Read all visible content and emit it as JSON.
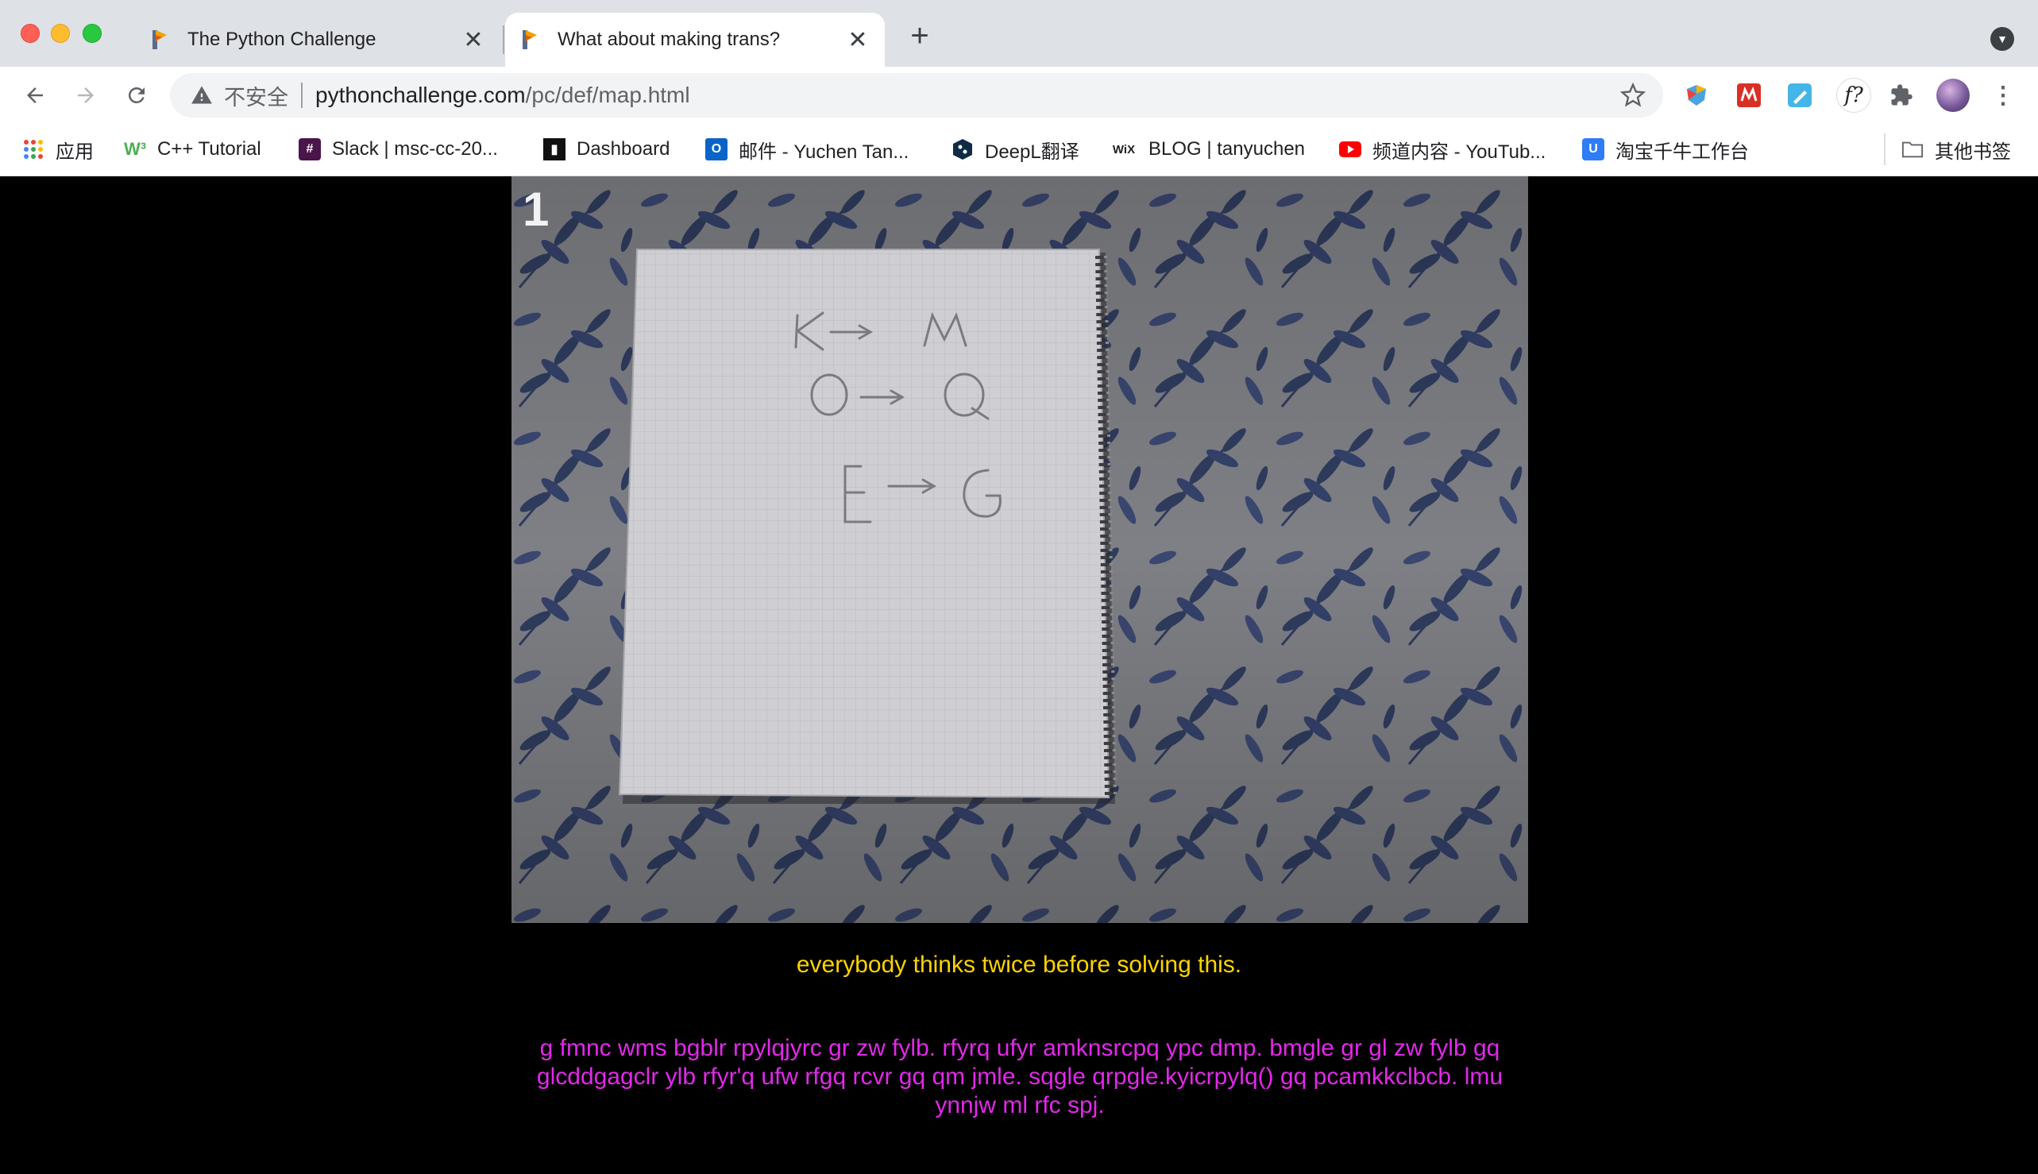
{
  "browser": {
    "tabs": [
      {
        "title": "The Python Challenge",
        "active": false
      },
      {
        "title": "What about making trans?",
        "active": true
      }
    ],
    "address": {
      "security_label": "不安全",
      "host": "pythonchallenge.com",
      "path": "/pc/def/map.html"
    },
    "extensions": [
      "colorful-shield-icon",
      "red-grid-extension-icon",
      "blue-pen-extension-icon",
      "formula-extension-icon",
      "puzzle-icon",
      "profile-avatar"
    ],
    "bookmarks": [
      {
        "label": "应用",
        "icon": "apps-grid-icon"
      },
      {
        "label": "C++ Tutorial",
        "icon": "w3schools-icon"
      },
      {
        "label": "Slack | msc-cc-20...",
        "icon": "slack-icon"
      },
      {
        "label": "Dashboard",
        "icon": "dashboard-icon"
      },
      {
        "label": "邮件 - Yuchen Tan...",
        "icon": "outlook-icon"
      },
      {
        "label": "DeepL翻译",
        "icon": "deepl-icon"
      },
      {
        "label": "BLOG | tanyuchen",
        "icon": "wix-icon"
      },
      {
        "label": "频道内容 - YouTub...",
        "icon": "youtube-icon"
      },
      {
        "label": "淘宝千牛工作台",
        "icon": "qianniu-icon"
      }
    ],
    "other_bookmarks": "其他书签"
  },
  "page": {
    "image": {
      "level_number": "1",
      "notebook_lines": [
        "K→M",
        "O→Q",
        "E→G"
      ]
    },
    "caption": "everybody thinks twice before solving this.",
    "cipher_text": "g fmnc wms bgblr rpylqjyrc gr zw fylb. rfyrq ufyr amknsrcpq ypc dmp. bmgle gr gl zw fylb gq glcddgagclr ylb rfyr'q ufw rfgq rcvr gq qm jmle. sqgle qrpgle.kyicrpylq() gq pcamkkclbcb. lmu ynnjw ml rfc spj."
  }
}
